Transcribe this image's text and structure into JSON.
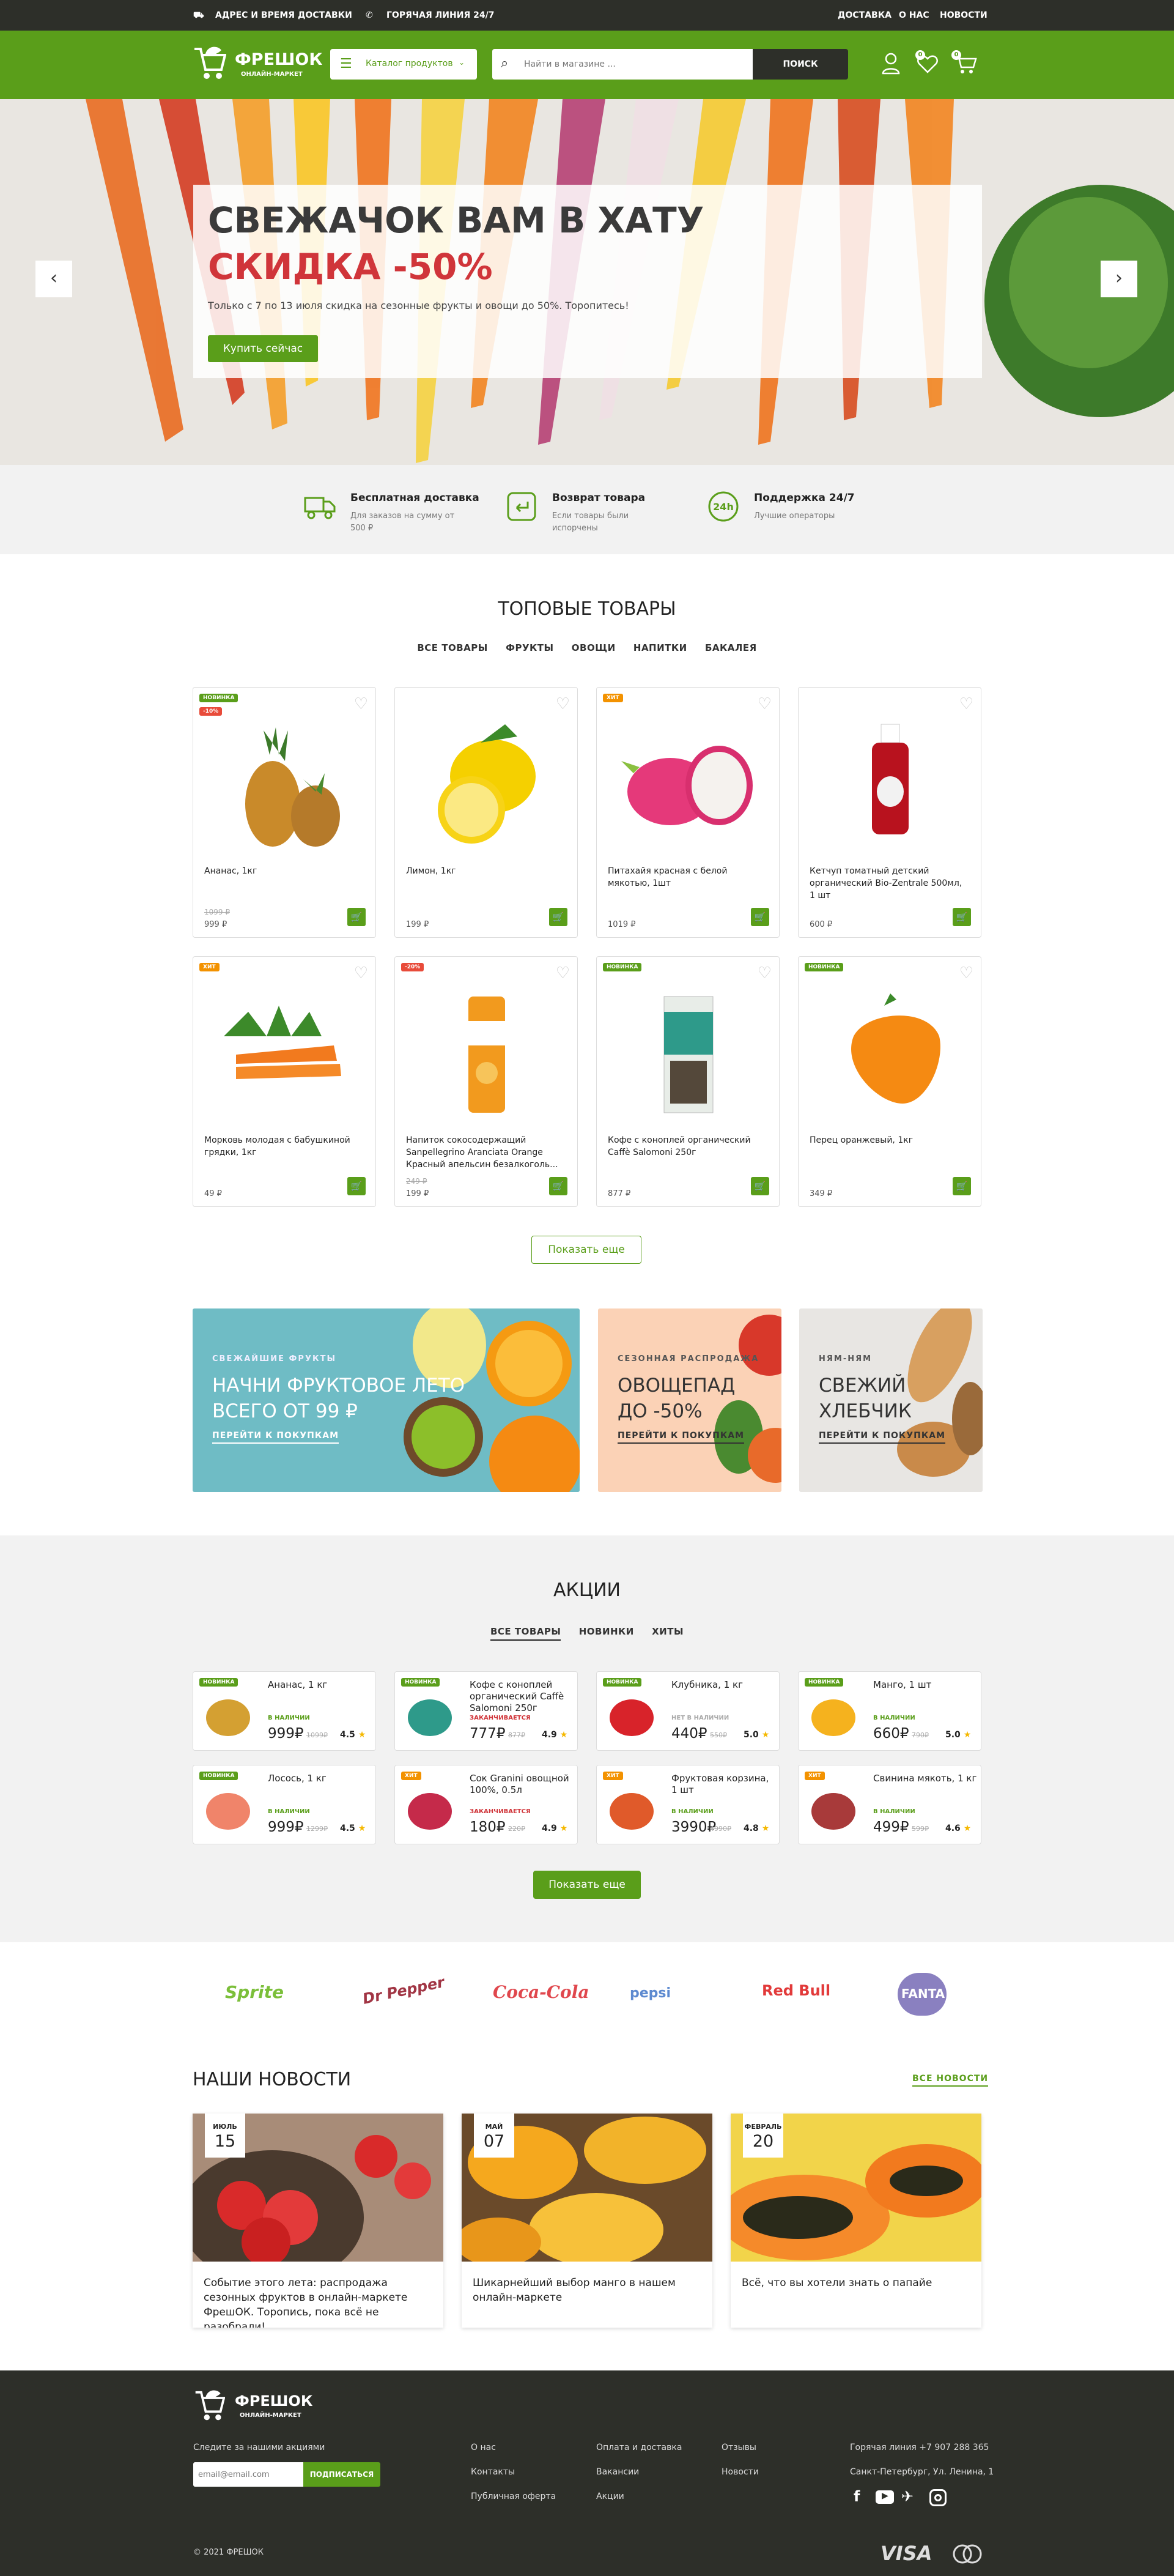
{
  "topbar": {
    "delivery": "АДРЕС И ВРЕМЯ ДОСТАВКИ",
    "hotline": "ГОРЯЧАЯ ЛИНИЯ 24/7",
    "nav": [
      "ДОСТАВКА",
      "О НАС",
      "НОВОСТИ"
    ]
  },
  "header": {
    "logo": "ФРЕШОК",
    "logo_sub": "ОНЛАЙН-МАРКЕТ",
    "catalog": "Каталог продуктов",
    "search_placeholder": "Найти в магазине ...",
    "search_button": "ПОИСК",
    "fav_count": "0",
    "cart_count": "0"
  },
  "hero": {
    "line1": "СВЕЖАЧОК ВАМ В ХАТУ",
    "line2": "СКИДКА -50%",
    "text": "Только с 7 по 13 июля скидка на сезонные фрукты и овощи до 50%. Торопитесь!",
    "button": "Купить сейчас"
  },
  "features": [
    {
      "title": "Бесплатная доставка",
      "text": "Для заказов на сумму от 500 ₽"
    },
    {
      "title": "Возврат товара",
      "text": "Если товары были испорчены"
    },
    {
      "title": "Поддержка 24/7",
      "text": "Лучшие операторы"
    }
  ],
  "top": {
    "title": "ТОПОВЫЕ ТОВАРЫ",
    "tabs": [
      "ВСЕ ТОВАРЫ",
      "ФРУКТЫ",
      "ОВОЩИ",
      "НАПИТКИ",
      "БАКАЛЕЯ"
    ],
    "more": "Показать еще",
    "products": [
      {
        "name": "Ананас, 1кг",
        "old": "1099 ₽",
        "price": "999 ₽",
        "badge": "НОВИНКА",
        "badge2": "-10%"
      },
      {
        "name": "Лимон, 1кг",
        "old": "",
        "price": "199 ₽",
        "badge": "",
        "badge2": ""
      },
      {
        "name": "Питахайя красная с белой мякотью, 1шт",
        "old": "",
        "price": "1019 ₽",
        "badge": "ХИТ",
        "badge2": ""
      },
      {
        "name": "Кетчуп томатный детский органический Bio-Zentrale 500мл, 1 шт",
        "old": "",
        "price": "600 ₽",
        "badge": "",
        "badge2": ""
      },
      {
        "name": "Морковь молодая с бабушкиной грядки, 1кг",
        "old": "",
        "price": "49 ₽",
        "badge": "ХИТ",
        "badge2": ""
      },
      {
        "name": "Напиток сокосодержащий Sanpellegrino Aranciata Orange Красный апельсин безалкоголь...",
        "old": "249 ₽",
        "price": "199 ₽",
        "badge": "-20%",
        "badge2": ""
      },
      {
        "name": "Кофе с коноплей органический Caffè Salomoni 250г",
        "old": "",
        "price": "877 ₽",
        "badge": "НОВИНКА",
        "badge2": ""
      },
      {
        "name": "Перец оранжевый, 1кг",
        "old": "",
        "price": "349 ₽",
        "badge": "НОВИНКА",
        "badge2": ""
      }
    ]
  },
  "promos": [
    {
      "small": "СВЕЖАЙШИЕ ФРУКТЫ",
      "big1": "НАЧНИ ФРУКТОВОЕ ЛЕТО",
      "big2": "ВСЕГО ОТ 99 ₽",
      "link": "ПЕРЕЙТИ К ПОКУПКАМ"
    },
    {
      "small": "СЕЗОННАЯ РАСПРОДАЖА",
      "big1": "ОВОЩЕПАД",
      "big2": "ДО -50%",
      "link": "ПЕРЕЙТИ К ПОКУПКАМ"
    },
    {
      "small": "НЯМ-НЯМ",
      "big1": "СВЕЖИЙ",
      "big2": "ХЛЕБЧИК",
      "link": "ПЕРЕЙТИ К ПОКУПКАМ"
    }
  ],
  "deals": {
    "title": "АКЦИИ",
    "tabs": [
      "ВСЕ ТОВАРЫ",
      "НОВИНКИ",
      "ХИТЫ"
    ],
    "more": "Показать еще",
    "items": [
      {
        "name": "Ананас, 1 кг",
        "badge": "НОВИНКА",
        "stock": "В НАЛИЧИИ",
        "price": "999₽",
        "old": "1099₽",
        "rating": "4.5"
      },
      {
        "name": "Кофе с коноплей органический Caffè Salomoni 250г",
        "badge": "НОВИНКА",
        "stock": "ЗАКАНЧИВАЕТСЯ",
        "price": "777₽",
        "old": "877₽",
        "rating": "4.9"
      },
      {
        "name": "Клубника, 1 кг",
        "badge": "НОВИНКА",
        "stock": "НЕТ В НАЛИЧИИ",
        "price": "440₽",
        "old": "550₽",
        "rating": "5.0"
      },
      {
        "name": "Манго, 1 шт",
        "badge": "НОВИНКА",
        "stock": "В НАЛИЧИИ",
        "price": "660₽",
        "old": "790₽",
        "rating": "5.0"
      },
      {
        "name": "Лосось, 1 кг",
        "badge": "НОВИНКА",
        "stock": "В НАЛИЧИИ",
        "price": "999₽",
        "old": "1299₽",
        "rating": "4.5"
      },
      {
        "name": "Сок Granini овощной 100%, 0.5л",
        "badge": "ХИТ",
        "stock": "ЗАКАНЧИВАЕТСЯ",
        "price": "180₽",
        "old": "220₽",
        "rating": "4.9"
      },
      {
        "name": "Фруктовая корзина, 1 шт",
        "badge": "ХИТ",
        "stock": "В НАЛИЧИИ",
        "price": "3990₽",
        "old": "4990₽",
        "rating": "4.8"
      },
      {
        "name": "Свинина мякоть, 1 кг",
        "badge": "ХИТ",
        "stock": "В НАЛИЧИИ",
        "price": "499₽",
        "old": "599₽",
        "rating": "4.6"
      }
    ]
  },
  "brands": [
    "Sprite",
    "Dr Pepper",
    "Coca-Cola",
    "pepsi",
    "Red Bull",
    "FANTA"
  ],
  "news": {
    "title": "НАШИ НОВОСТИ",
    "all": "ВСЕ НОВОСТИ",
    "items": [
      {
        "month": "ИЮЛЬ",
        "day": "15",
        "text": "Событие этого лета: распродажа сезонных фруктов в онлайн-маркете ФрешОК. Торопись, пока всё не разобрали!"
      },
      {
        "month": "МАЙ",
        "day": "07",
        "text": "Шикарнейший выбор манго в нашем онлайн-маркете"
      },
      {
        "month": "ФЕВРАЛЬ",
        "day": "20",
        "text": "Всё, что вы хотели знать о папайе"
      }
    ]
  },
  "footer": {
    "subscribe_label": "Следите за нашими акциями",
    "email_placeholder": "email@email.com",
    "subscribe_btn": "ПОДПИСАТЬСЯ",
    "col1": [
      "О нас",
      "Контакты",
      "Публичная оферта"
    ],
    "col2": [
      "Оплата и доставка",
      "Вакансии",
      "Акции"
    ],
    "col3": [
      "Отзывы",
      "Новости"
    ],
    "phone": "Горячая линия +7 907 288 365",
    "address": "Санкт-Петербург, Ул. Ленина, 1",
    "copy": "© 2021 ФРЕШОК",
    "visa": "VISA"
  },
  "colors": {
    "green": "#5a9e1a",
    "dark": "#2d2f29",
    "red": "#d0353a",
    "orange": "#f39200"
  }
}
